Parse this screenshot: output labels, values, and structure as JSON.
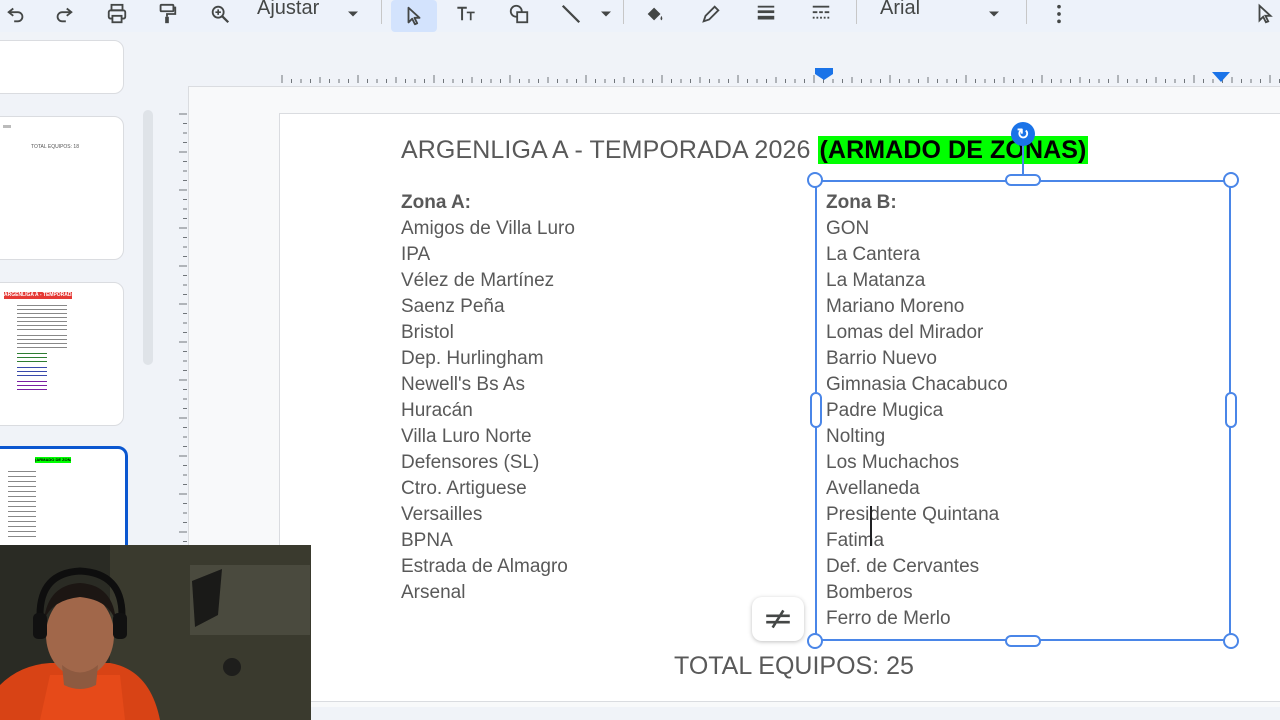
{
  "toolbar": {
    "zoom_label": "Ajustar",
    "font_name": "Arial"
  },
  "slide": {
    "title_main": "ARGENLIGA A - TEMPORADA 2026",
    "title_highlight": "(ARMADO DE ZONAS)",
    "zone_a": {
      "heading": "Zona A:",
      "teams": [
        "Amigos de Villa Luro",
        "IPA",
        "Vélez de Martínez",
        "Saenz Peña",
        "Bristol",
        "Dep. Hurlingham",
        "Newell's Bs As",
        "Huracán",
        "Villa Luro Norte",
        "Defensores (SL)",
        "Ctro. Artiguese",
        "Versailles",
        "BPNA",
        "Estrada de Almagro",
        "Arsenal"
      ]
    },
    "zone_b": {
      "heading": "Zona B:",
      "teams": [
        "GON",
        "La Cantera",
        "La Matanza",
        "Mariano Moreno",
        "Lomas del Mirador",
        "Barrio Nuevo",
        "Gimnasia Chacabuco",
        "Padre Mugica",
        "Nolting",
        "Los Muchachos",
        "Avellaneda",
        "Presidente Quintana",
        "Fatima",
        "Def. de Cervantes",
        "Bomberos",
        "Ferro de Merlo"
      ]
    },
    "total": "TOTAL EQUIPOS: 25"
  },
  "thumbnails": {
    "slide2_caption": "TOTAL EQUIPOS: 18",
    "slide3_title": "ARGENLIGA A - TEMPORADA 2026 (ARMADO DE ZONAS)",
    "slide4_title": "(ARMADO DE ZONAS)"
  },
  "colors": {
    "accent": "#4a86e8",
    "highlight": "#00ff00",
    "text": "#595959"
  }
}
